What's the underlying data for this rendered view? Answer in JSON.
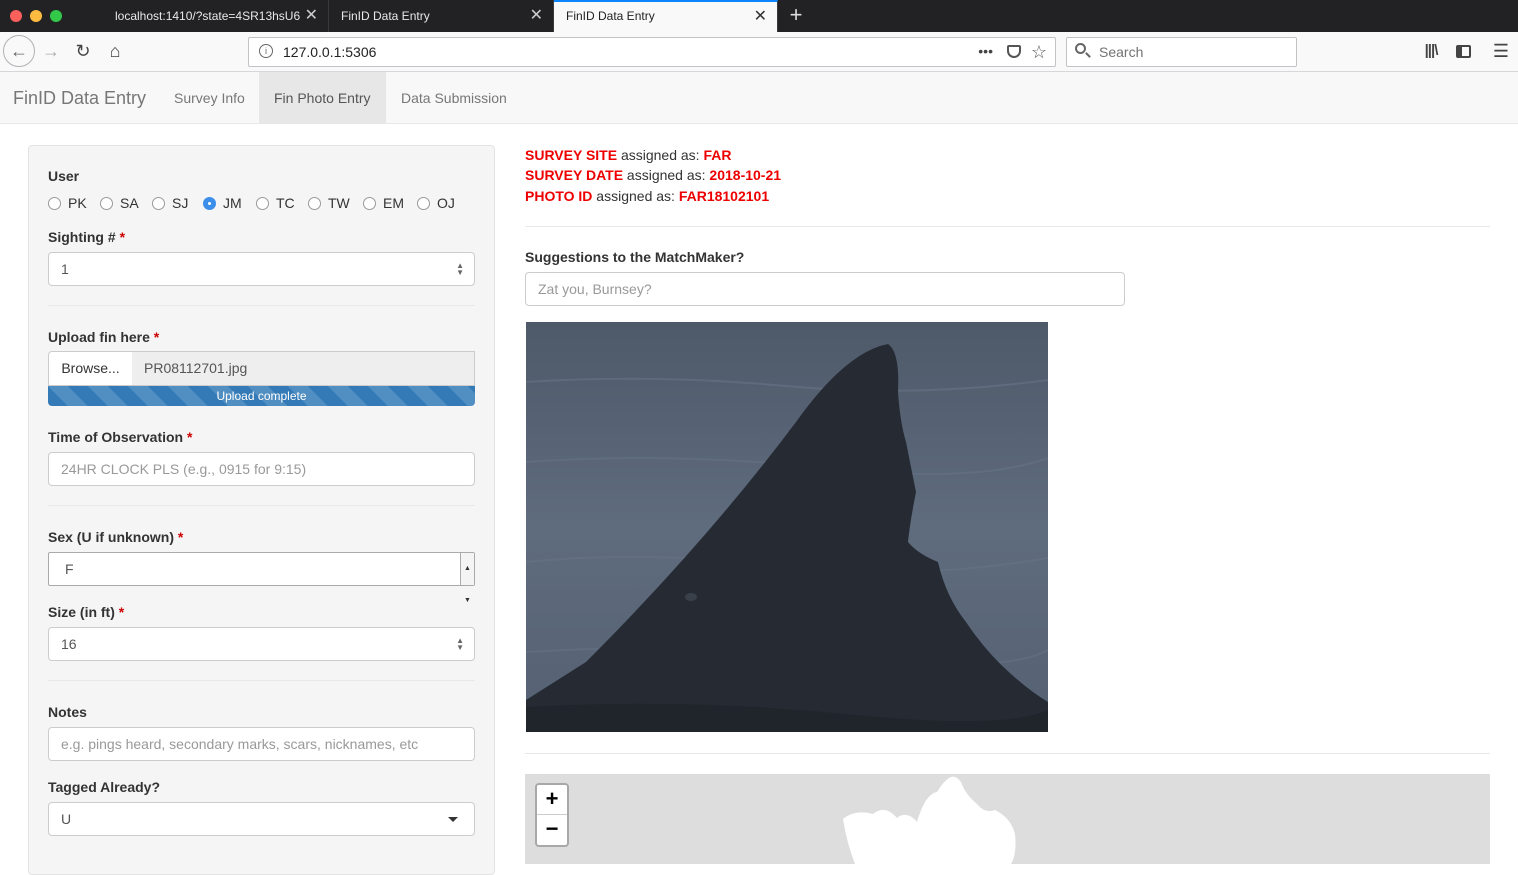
{
  "browser": {
    "tabs": [
      {
        "label": "localhost:1410/?state=4SR13hsU6",
        "active": false
      },
      {
        "label": "FinID Data Entry",
        "active": false
      },
      {
        "label": "FinID Data Entry",
        "active": true
      }
    ],
    "new_tab": "+",
    "url": "127.0.0.1:5306",
    "search_placeholder": "Search",
    "page_actions": "•••"
  },
  "app": {
    "brand": "FinID Data Entry",
    "nav": [
      {
        "label": "Survey Info",
        "active": false
      },
      {
        "label": "Fin Photo Entry",
        "active": true
      },
      {
        "label": "Data Submission",
        "active": false
      }
    ]
  },
  "form": {
    "user": {
      "label": "User",
      "options": [
        "PK",
        "SA",
        "SJ",
        "JM",
        "TC",
        "TW",
        "EM",
        "OJ"
      ],
      "selected": "JM"
    },
    "required_mark": "*",
    "sighting": {
      "label": "Sighting #",
      "value": "1"
    },
    "upload": {
      "label": "Upload fin here",
      "browse_label": "Browse...",
      "filename": "PR08112701.jpg",
      "progress_text": "Upload complete",
      "progress": 1.0
    },
    "time": {
      "label": "Time of Observation",
      "placeholder": "24HR CLOCK PLS (e.g., 0915 for 9:15)"
    },
    "sex": {
      "label": "Sex (U if unknown)",
      "value": "F"
    },
    "size": {
      "label": "Size (in ft)",
      "value": "16"
    },
    "notes": {
      "label": "Notes",
      "placeholder": "e.g. pings heard, secondary marks, scars, nicknames, etc"
    },
    "tagged": {
      "label": "Tagged Already?",
      "value": "U"
    }
  },
  "assignments": [
    {
      "key": "SURVEY SITE",
      "mid": " assigned as: ",
      "value": "FAR"
    },
    {
      "key": "SURVEY DATE",
      "mid": " assigned as: ",
      "value": "2018-10-21"
    },
    {
      "key": "PHOTO ID",
      "mid": " assigned as: ",
      "value": "FAR18102101"
    }
  ],
  "matchmaker": {
    "label": "Suggestions to the MatchMaker?",
    "placeholder": "Zat you, Burnsey?"
  },
  "map": {
    "zoom_in": "+",
    "zoom_out": "−"
  },
  "colors": {
    "accent": "#337ab7",
    "required": "#cc0000",
    "assigned": "#ee0000",
    "radio_on": "#3b8eea"
  }
}
